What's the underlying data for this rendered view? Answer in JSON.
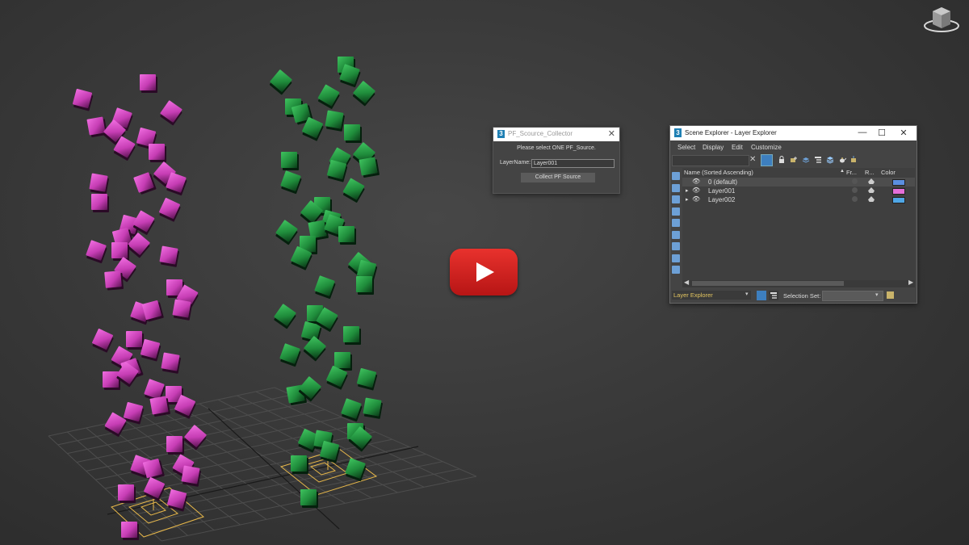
{
  "pf_dialog": {
    "title": "PF_Scource_Collector",
    "close_glyph": "✕",
    "message": "Please select ONE PF_Source.",
    "layer_label": "LayerName:",
    "layer_value": "Layer001",
    "collect_button": "Collect PF Source"
  },
  "scene_explorer": {
    "title": "Scene Explorer - Layer Explorer",
    "window_controls": {
      "minimize": "—",
      "maximize": "☐",
      "close": "✕"
    },
    "menus": [
      "Select",
      "Display",
      "Edit",
      "Customize"
    ],
    "columns": {
      "name": "Name (Sorted Ascending)",
      "freeze": "Fr...",
      "render": "R...",
      "color": "Color"
    },
    "rows": [
      {
        "name": "0 (default)",
        "color": "#5b8fe0",
        "selected": true
      },
      {
        "name": "Layer001",
        "color": "#e46fd8",
        "selected": false
      },
      {
        "name": "Layer002",
        "color": "#4fa7e6",
        "selected": false
      }
    ],
    "bottom": {
      "explorer_name": "Layer Explorer",
      "selection_set_label": "Selection Set:"
    }
  },
  "icons": [
    "app-3ds-icon",
    "viewcube-icon",
    "play-icon",
    "lock-icon",
    "eye-icon",
    "teapot-icon",
    "filter-icon"
  ],
  "colors": {
    "pink_cubes": "#d04ec0",
    "green_cubes": "#1f8c3b",
    "play_red": "#d4221f",
    "selection_gizmo": "#e8b84a"
  }
}
